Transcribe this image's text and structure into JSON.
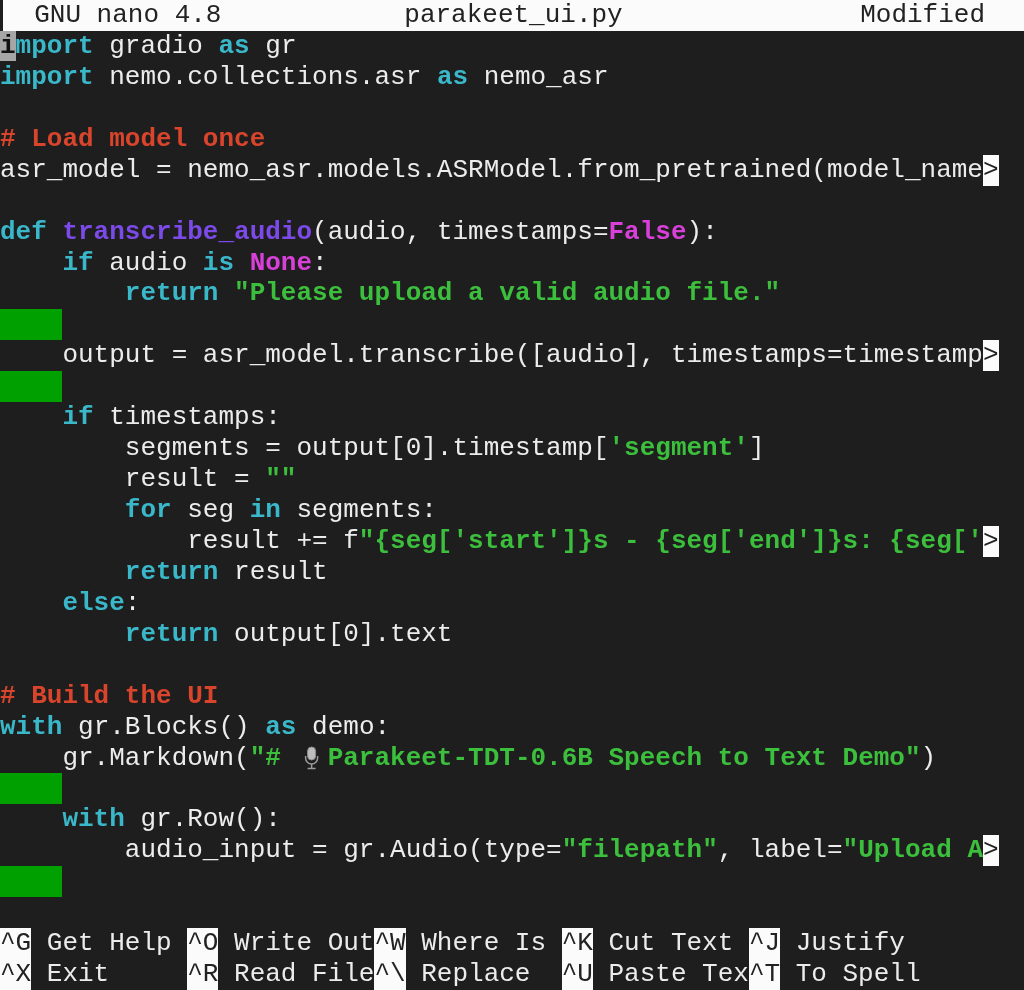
{
  "title_bar": {
    "app": "GNU nano 4.8",
    "filename": "parakeet_ui.py",
    "status": "Modified"
  },
  "lines": [
    {
      "kind": "code",
      "tokens": [
        {
          "text": "i",
          "kind": "cursor"
        },
        {
          "text": "mport",
          "kind": "keyword"
        },
        {
          "text": " gradio ",
          "kind": "plain"
        },
        {
          "text": "as",
          "kind": "keyword"
        },
        {
          "text": " gr",
          "kind": "plain"
        }
      ]
    },
    {
      "kind": "code",
      "tokens": [
        {
          "text": "import",
          "kind": "keyword"
        },
        {
          "text": " nemo.collections.asr ",
          "kind": "plain"
        },
        {
          "text": "as",
          "kind": "keyword"
        },
        {
          "text": " nemo_asr",
          "kind": "plain"
        }
      ]
    },
    {
      "kind": "blank"
    },
    {
      "kind": "code",
      "tokens": [
        {
          "text": "# Load model once",
          "kind": "comment"
        }
      ]
    },
    {
      "kind": "code",
      "tokens": [
        {
          "text": "asr_model = nemo_asr.models.ASRModel.from_pretrained(model_name",
          "kind": "plain"
        },
        {
          "text": ">",
          "kind": "marker"
        }
      ]
    },
    {
      "kind": "blank"
    },
    {
      "kind": "code",
      "tokens": [
        {
          "text": "def",
          "kind": "keyword"
        },
        {
          "text": " transcribe_audio",
          "kind": "function"
        },
        {
          "text": "(audio, timestamps=",
          "kind": "plain"
        },
        {
          "text": "False",
          "kind": "constant"
        },
        {
          "text": "):",
          "kind": "plain"
        }
      ]
    },
    {
      "kind": "code",
      "tokens": [
        {
          "text": "    if",
          "kind": "keyword"
        },
        {
          "text": " audio ",
          "kind": "plain"
        },
        {
          "text": "is",
          "kind": "keyword"
        },
        {
          "text": " None",
          "kind": "constant"
        },
        {
          "text": ":",
          "kind": "plain"
        }
      ]
    },
    {
      "kind": "code",
      "tokens": [
        {
          "text": "        return",
          "kind": "keyword"
        },
        {
          "text": " \"Please upload a valid audio file.\"",
          "kind": "string"
        }
      ]
    },
    {
      "kind": "whitespace"
    },
    {
      "kind": "code",
      "tokens": [
        {
          "text": "    output = asr_model.transcribe([audio], timestamps=timestamp",
          "kind": "plain"
        },
        {
          "text": ">",
          "kind": "marker"
        }
      ]
    },
    {
      "kind": "whitespace"
    },
    {
      "kind": "code",
      "tokens": [
        {
          "text": "    if",
          "kind": "keyword"
        },
        {
          "text": " timestamps:",
          "kind": "plain"
        }
      ]
    },
    {
      "kind": "code",
      "tokens": [
        {
          "text": "        segments = output[0].timestamp[",
          "kind": "plain"
        },
        {
          "text": "'segment'",
          "kind": "string"
        },
        {
          "text": "]",
          "kind": "plain"
        }
      ]
    },
    {
      "kind": "code",
      "tokens": [
        {
          "text": "        result = ",
          "kind": "plain"
        },
        {
          "text": "\"\"",
          "kind": "string"
        }
      ]
    },
    {
      "kind": "code",
      "tokens": [
        {
          "text": "        for",
          "kind": "keyword"
        },
        {
          "text": " seg ",
          "kind": "plain"
        },
        {
          "text": "in",
          "kind": "keyword"
        },
        {
          "text": " segments:",
          "kind": "plain"
        }
      ]
    },
    {
      "kind": "code",
      "tokens": [
        {
          "text": "            result += f",
          "kind": "plain"
        },
        {
          "text": "\"{seg['start']}s - {seg['end']}s: {seg['",
          "kind": "string"
        },
        {
          "text": ">",
          "kind": "marker"
        }
      ]
    },
    {
      "kind": "code",
      "tokens": [
        {
          "text": "        return",
          "kind": "keyword"
        },
        {
          "text": " result",
          "kind": "plain"
        }
      ]
    },
    {
      "kind": "code",
      "tokens": [
        {
          "text": "    else",
          "kind": "keyword"
        },
        {
          "text": ":",
          "kind": "plain"
        }
      ]
    },
    {
      "kind": "code",
      "tokens": [
        {
          "text": "        return",
          "kind": "keyword"
        },
        {
          "text": " output[0].text",
          "kind": "plain"
        }
      ]
    },
    {
      "kind": "blank"
    },
    {
      "kind": "code",
      "tokens": [
        {
          "text": "# Build the UI",
          "kind": "comment"
        }
      ]
    },
    {
      "kind": "code",
      "tokens": [
        {
          "text": "with",
          "kind": "keyword"
        },
        {
          "text": " gr.Blocks() ",
          "kind": "plain"
        },
        {
          "text": "as",
          "kind": "keyword"
        },
        {
          "text": " demo:",
          "kind": "plain"
        }
      ]
    },
    {
      "kind": "code",
      "tokens": [
        {
          "text": "    gr.Markdown(",
          "kind": "plain"
        },
        {
          "text": "\"# ",
          "kind": "string"
        },
        {
          "kind": "icon"
        },
        {
          "text": "Parakeet-TDT-0.6B Speech to Text Demo\"",
          "kind": "string"
        },
        {
          "text": ")",
          "kind": "plain"
        }
      ]
    },
    {
      "kind": "whitespace"
    },
    {
      "kind": "code",
      "tokens": [
        {
          "text": "    with",
          "kind": "keyword"
        },
        {
          "text": " gr.Row():",
          "kind": "plain"
        }
      ]
    },
    {
      "kind": "code",
      "tokens": [
        {
          "text": "        audio_input = gr.Audio(type=",
          "kind": "plain"
        },
        {
          "text": "\"filepath\"",
          "kind": "string"
        },
        {
          "text": ", label=",
          "kind": "plain"
        },
        {
          "text": "\"Upload A",
          "kind": "string"
        },
        {
          "text": ">",
          "kind": "marker"
        }
      ]
    },
    {
      "kind": "whitespace"
    },
    {
      "kind": "blank"
    }
  ],
  "shortcuts": [
    [
      {
        "key": "^G",
        "label": "Get Help"
      },
      {
        "key": "^O",
        "label": "Write Out"
      },
      {
        "key": "^W",
        "label": "Where Is"
      },
      {
        "key": "^K",
        "label": "Cut Text"
      },
      {
        "key": "^J",
        "label": "Justify"
      }
    ],
    [
      {
        "key": "^X",
        "label": "Exit"
      },
      {
        "key": "^R",
        "label": "Read File"
      },
      {
        "key": "^\\",
        "label": "Replace"
      },
      {
        "key": "^U",
        "label": "Paste Tex"
      },
      {
        "key": "^T",
        "label": "To Spell"
      }
    ]
  ]
}
